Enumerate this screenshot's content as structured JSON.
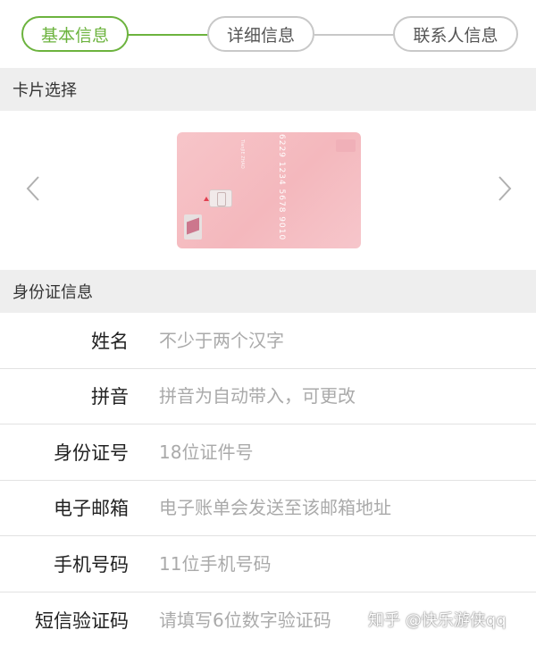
{
  "stepper": {
    "steps": [
      {
        "label": "基本信息",
        "active": true
      },
      {
        "label": "详细信息",
        "active": false
      },
      {
        "label": "联系人信息",
        "active": false
      }
    ],
    "active_color": "#6cb33e",
    "inactive_color": "#c8c8c8"
  },
  "card_section": {
    "title": "卡片选择",
    "card": {
      "number": "6229 1234 5678 9010",
      "color": "#f4b8bd"
    },
    "prev_icon": "chevron-left-icon",
    "next_icon": "chevron-right-icon"
  },
  "id_section": {
    "title": "身份证信息",
    "fields": [
      {
        "label": "姓名",
        "placeholder": "不少于两个汉字"
      },
      {
        "label": "拼音",
        "placeholder": "拼音为自动带入，可更改"
      },
      {
        "label": "身份证号",
        "placeholder": "18位证件号"
      },
      {
        "label": "电子邮箱",
        "placeholder": "电子账单会发送至该邮箱地址"
      },
      {
        "label": "手机号码",
        "placeholder": "11位手机号码"
      },
      {
        "label": "短信验证码",
        "placeholder": "请填写6位数字验证码"
      }
    ]
  },
  "watermark": "知乎 @快乐游侠qq"
}
